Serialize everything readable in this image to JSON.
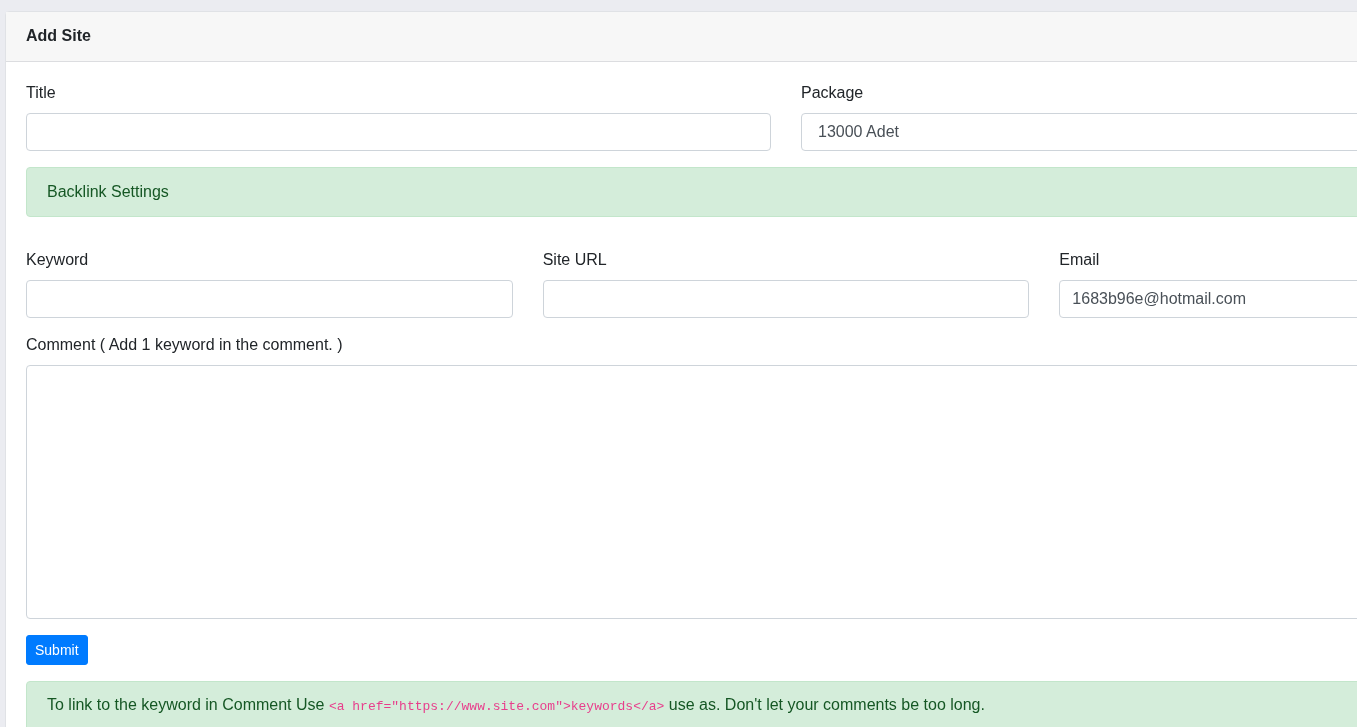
{
  "card": {
    "title": "Add Site"
  },
  "title_field": {
    "label": "Title"
  },
  "package_field": {
    "label": "Package",
    "value": "13000 Adet"
  },
  "backlink_alert": {
    "text": "Backlink Settings"
  },
  "fields": [
    {
      "label": "Keyword"
    },
    {
      "label": "Site URL"
    },
    {
      "label": "Email",
      "value": "1683b96e@hotmail.com"
    }
  ],
  "comment": {
    "label": "Comment ( Add 1 keyword in the comment. )"
  },
  "submit": {
    "label": "Submit"
  },
  "hint": {
    "before": "To link to the keyword in Comment Use",
    "code": "<a href=\"https://www.site.com\">keywords</a>",
    "after": "use as. Don't let your comments be too long."
  }
}
